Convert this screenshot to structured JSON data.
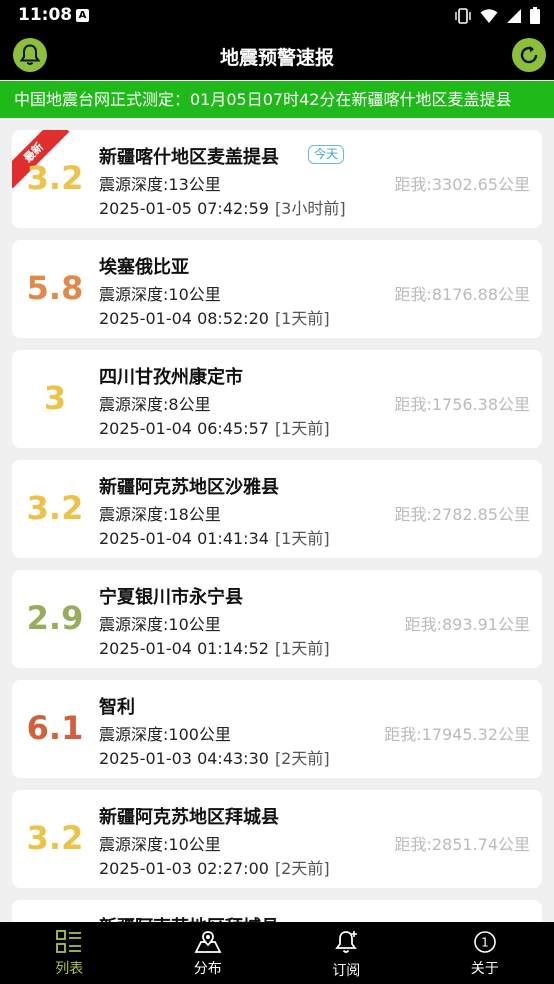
{
  "status_bar": {
    "time": "11:08",
    "notif_glyph": "A"
  },
  "app_bar": {
    "title": "地震预警速报"
  },
  "ticker": {
    "text": "中国地震台网正式测定：01月05日07时42分在新疆喀什地区麦盖提县"
  },
  "colors": {
    "accent_green": "#1fb91a",
    "round_button": "#8cc03c",
    "nav_active": "#a6c64a",
    "ribbon_red": "#e02e2e"
  },
  "list": {
    "items": [
      {
        "mag": "3.2",
        "mag_color": "#edc248",
        "place": "新疆喀什地区麦盖提县",
        "badge": "今天",
        "ribbon": "最新",
        "depth": "震源深度:13公里",
        "datetime": "2025-01-05 07:42:59",
        "ago": "[3小时前]",
        "dist": "距我:3302.65公里"
      },
      {
        "mag": "5.8",
        "mag_color": "#e08a4a",
        "place": "埃塞俄比亚",
        "depth": "震源深度:10公里",
        "datetime": "2025-01-04 08:52:20",
        "ago": "[1天前]",
        "dist": "距我:8176.88公里"
      },
      {
        "mag": "3",
        "mag_color": "#edc248",
        "place": "四川甘孜州康定市",
        "depth": "震源深度:8公里",
        "datetime": "2025-01-04 06:45:57",
        "ago": "[1天前]",
        "dist": "距我:1756.38公里"
      },
      {
        "mag": "3.2",
        "mag_color": "#edc248",
        "place": "新疆阿克苏地区沙雅县",
        "depth": "震源深度:18公里",
        "datetime": "2025-01-04 01:41:34",
        "ago": "[1天前]",
        "dist": "距我:2782.85公里"
      },
      {
        "mag": "2.9",
        "mag_color": "#98ad5c",
        "place": "宁夏银川市永宁县",
        "depth": "震源深度:10公里",
        "datetime": "2025-01-04 01:14:52",
        "ago": "[1天前]",
        "dist": "距我:893.91公里"
      },
      {
        "mag": "6.1",
        "mag_color": "#d2603d",
        "place": "智利",
        "depth": "震源深度:100公里",
        "datetime": "2025-01-03 04:43:30",
        "ago": "[2天前]",
        "dist": "距我:17945.32公里"
      },
      {
        "mag": "3.2",
        "mag_color": "#edc248",
        "place": "新疆阿克苏地区拜城县",
        "depth": "震源深度:10公里",
        "datetime": "2025-01-03 02:27:00",
        "ago": "[2天前]",
        "dist": "距我:2851.74公里"
      },
      {
        "mag": "",
        "mag_color": "#edc248",
        "place": "新疆阿克苏地区拜城县",
        "depth": "",
        "datetime": "",
        "ago": "",
        "dist": ""
      }
    ]
  },
  "bottom_nav": {
    "items": [
      {
        "label": "列表",
        "icon": "list-icon"
      },
      {
        "label": "分布",
        "icon": "map-icon"
      },
      {
        "label": "订阅",
        "icon": "bell-add-icon"
      },
      {
        "label": "关于",
        "icon": "info-icon"
      }
    ]
  }
}
